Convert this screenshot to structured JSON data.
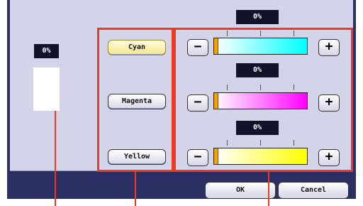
{
  "preview": {
    "value": "0%"
  },
  "colors": [
    {
      "label": "Cyan",
      "value": "0%",
      "selected": true,
      "gradient": [
        "#ffffff",
        "#00ffff"
      ]
    },
    {
      "label": "Magenta",
      "value": "0%",
      "selected": false,
      "gradient": [
        "#ffffff",
        "#ff00ff"
      ]
    },
    {
      "label": "Yellow",
      "value": "0%",
      "selected": false,
      "gradient": [
        "#ffffff",
        "#ffff00"
      ]
    }
  ],
  "buttons": {
    "minus": "−",
    "plus": "+",
    "ok": "OK",
    "cancel": "Cancel"
  },
  "theme": {
    "panel": "#d3d4ea",
    "frame": "#2b2f63",
    "callout": "#ee3a1d",
    "marker": "#f2a400"
  }
}
